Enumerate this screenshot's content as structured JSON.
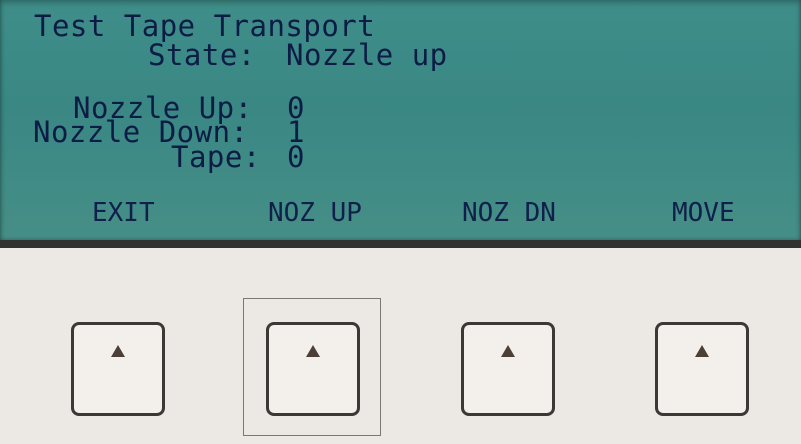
{
  "screen": {
    "title": "Test Tape Transport",
    "state_label": "State:",
    "state_value": "Nozzle up",
    "readings": [
      {
        "label": "Nozzle Up:",
        "value": "0"
      },
      {
        "label": "Nozzle Down:",
        "value": "1"
      },
      {
        "label": "Tape:",
        "value": "0"
      }
    ],
    "softkeys": [
      "EXIT",
      "NOZ UP",
      "NOZ DN",
      "MOVE"
    ]
  },
  "keys": [
    {
      "icon": "up-triangle-icon"
    },
    {
      "icon": "up-triangle-icon",
      "highlighted": true
    },
    {
      "icon": "up-triangle-icon"
    },
    {
      "icon": "up-triangle-icon"
    }
  ],
  "colors": {
    "lcd_background": "#3f8e8a",
    "lcd_text": "#0c1c45",
    "panel_background": "#eae6e1",
    "key_border": "#3b3836",
    "key_arrow": "#4b3f36"
  }
}
